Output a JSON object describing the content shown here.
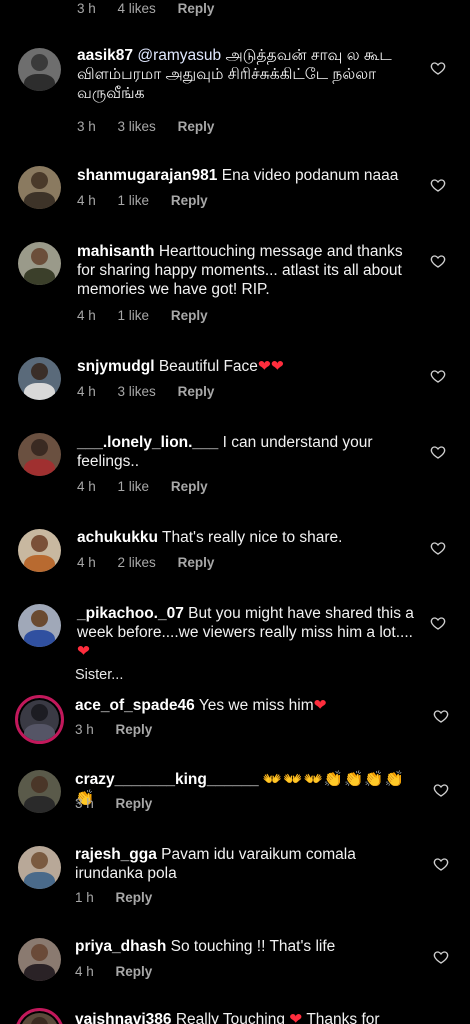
{
  "top_meta": {
    "time": "3 h",
    "likes": "4 likes",
    "reply": "Reply"
  },
  "comments": [
    {
      "username": "aasik87",
      "mention": "@ramyasub",
      "text": "அடுத்தவன் சாவு ல கூட விளம்பரமா அதுவும் சிரிச்சுக்கிட்டே நல்லா வருவீங்க",
      "time": "3 h",
      "likes": "3 likes",
      "reply": "Reply"
    },
    {
      "username": "shanmugarajan981",
      "text": "Ena video podanum naaa",
      "time": "4 h",
      "likes": "1 like",
      "reply": "Reply"
    },
    {
      "username": "mahisanth",
      "text": "Hearttouching message and thanks for sharing happy moments... atlast its all about memories we have got! RIP.",
      "time": "4 h",
      "likes": "1 like",
      "reply": "Reply"
    },
    {
      "username": "snjymudgl",
      "text": "Beautiful Face",
      "emoji": "❤❤",
      "time": "4 h",
      "likes": "3 likes",
      "reply": "Reply"
    },
    {
      "username": "___.lonely_lion.___",
      "text": "I can understand your feelings..",
      "time": "4 h",
      "likes": "1 like",
      "reply": "Reply"
    },
    {
      "username": "achukukku",
      "text": "That's really nice to share.",
      "time": "4 h",
      "likes": "2 likes",
      "reply": "Reply"
    },
    {
      "username": "_pikachoo._07",
      "text": "But you might have shared this a week before....we viewers really miss him a lot....",
      "emoji": "❤",
      "more": "Sister..."
    },
    {
      "username": "ace_of_spade46",
      "text": "Yes we miss him",
      "emoji": "❤",
      "time": "3 h",
      "reply": "Reply"
    },
    {
      "username": "crazy_______king______",
      "emoji": "👐👐👐👏👏👏👏👏",
      "time": "3 h",
      "reply": "Reply"
    },
    {
      "username": "rajesh_gga",
      "text": "Pavam idu varaikum comala irundanka pola",
      "time": "1 h",
      "reply": "Reply"
    },
    {
      "username": "priya_dhash",
      "text": "So touching !! That's life",
      "time": "4 h",
      "reply": "Reply"
    },
    {
      "username": "vaishnavi386",
      "text": "Really Touching",
      "emoji": "❤",
      "text2": "Thanks for"
    }
  ],
  "colors": {
    "background": "#000000",
    "meta_text": "#a8a8a8",
    "heart_red": "#ff2d3d",
    "story_ring": "#c2185b"
  }
}
